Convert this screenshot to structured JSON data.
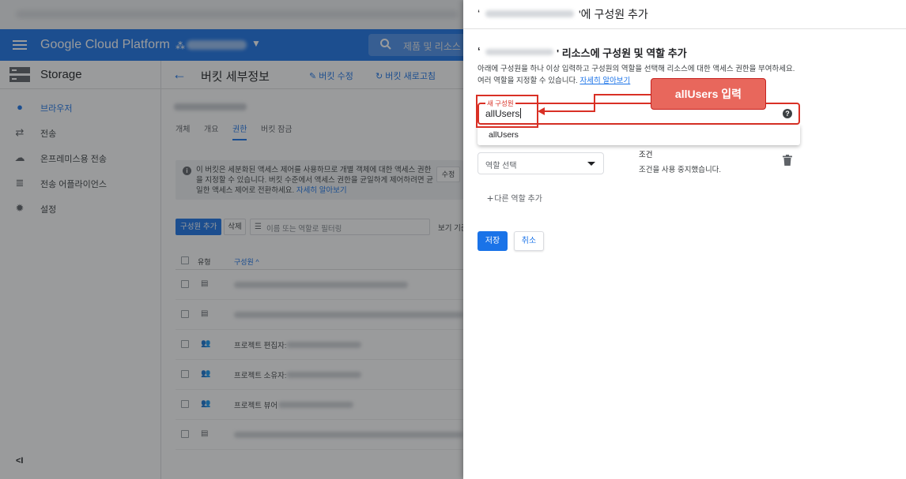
{
  "header": {
    "product_name": "Google Cloud Platform",
    "search_placeholder": "제품 및 리소스 검"
  },
  "sidebar": {
    "title": "Storage",
    "items": [
      {
        "label": "브라우저",
        "icon": "bucket-icon",
        "active": true
      },
      {
        "label": "전송",
        "icon": "transfer-icon",
        "active": false
      },
      {
        "label": "온프레미스용 전송",
        "icon": "cloud-upload-icon",
        "active": false
      },
      {
        "label": "전송 어플라이언스",
        "icon": "appliance-icon",
        "active": false
      },
      {
        "label": "설정",
        "icon": "gear-icon",
        "active": false
      }
    ],
    "collapse_label": "<I"
  },
  "main": {
    "title": "버킷 세부정보",
    "edit_label": "버킷 수정",
    "refresh_label": "버킷 새로고침",
    "tabs": [
      "개체",
      "개요",
      "권한",
      "버킷 잠금"
    ],
    "active_tab": "권한",
    "notice": {
      "text": "이 버킷은 세분화된 액세스 제어를 사용하므로 개별 객체에 대한 액세스 권한을 지정할 수 있습니다. 버킷 수준에서 액세스 권한을 균일하게 제어하려면 균일한 액세스 제어로 전환하세요.",
      "link": "자세히 알아보기",
      "button": "수정"
    },
    "toolbar": {
      "add_member": "구성원 추가",
      "delete": "삭제",
      "filter_placeholder": "이름 또는 역할로 필터링",
      "view_by": "보기 기준"
    },
    "table": {
      "columns": [
        "유형",
        "구성원 ^"
      ],
      "rows": [
        {
          "type": "아이콘",
          "label": ""
        },
        {
          "type": "아이콘",
          "label": ""
        },
        {
          "type": "group",
          "label": "프로젝트 편집자:"
        },
        {
          "type": "group",
          "label": "프로젝트 소유자:"
        },
        {
          "type": "group",
          "label": "프로젝트 뷰어"
        },
        {
          "type": "아이콘",
          "label": ""
        }
      ]
    }
  },
  "panel": {
    "header_title_suffix": "'에 구성원 추가",
    "section_title_suffix": "' 리소스에 구성원 및 역할 추가",
    "description": "아래에 구성원을 하나 이상 입력하고 구성원의 역할을 선택해 리소스에 대한 액세스 권한을 부여하세요. 여러 역할을 지정할 수 있습니다.",
    "description_link": "자세히 알아보기",
    "member_field_label": "새 구성원",
    "member_field_value": "allUsers",
    "suggestion": "allUsers",
    "role_placeholder": "역할 선택",
    "condition_title": "조건",
    "condition_desc": "조건을 사용 중지했습니다.",
    "add_role": "다른 역할 추가",
    "save": "저장",
    "cancel": "취소"
  },
  "annotation": {
    "callout_text": "allUsers 입력",
    "color": "#d93025"
  },
  "colors": {
    "primary": "#1a73e8",
    "annotation_red": "#d93025"
  }
}
